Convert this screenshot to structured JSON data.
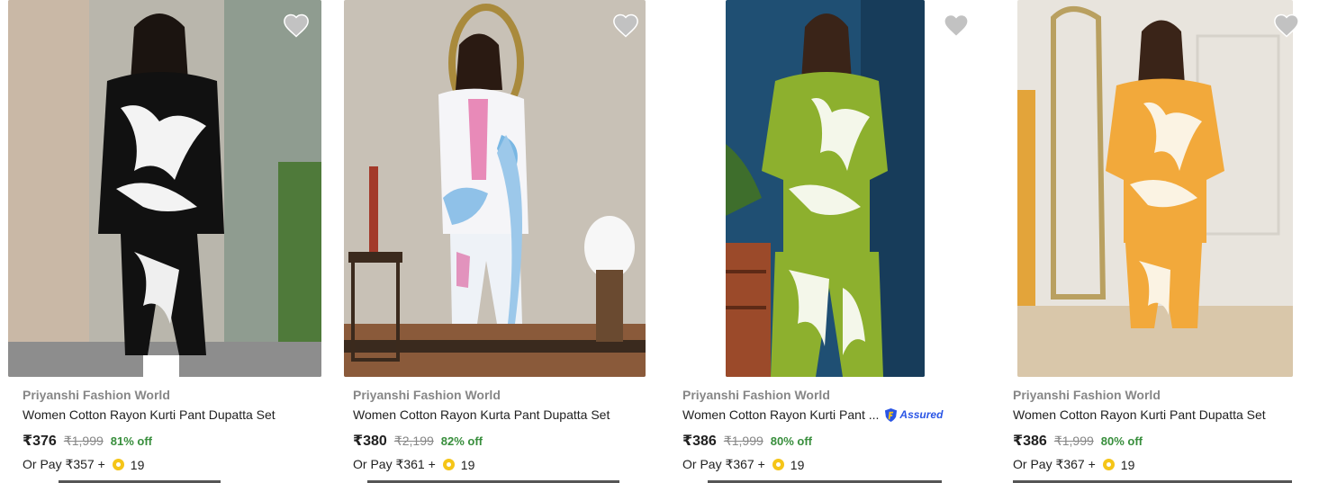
{
  "products": [
    {
      "brand": "Priyanshi Fashion World",
      "title": "Women Cotton Rayon Kurti Pant Dupatta Set",
      "price": "₹376",
      "mrp": "₹1,999",
      "discount": "81% off",
      "pay_prefix": "Or Pay ₹357 +",
      "coins": "19",
      "assured": false,
      "wishlist_icon": "heart-icon",
      "image_desc_color": "#1a1a1a"
    },
    {
      "brand": "Priyanshi Fashion World",
      "title": "Women Cotton Rayon Kurta Pant Dupatta Set",
      "price": "₹380",
      "mrp": "₹2,199",
      "discount": "82% off",
      "pay_prefix": "Or Pay ₹361 +",
      "coins": "19",
      "assured": false,
      "wishlist_icon": "heart-icon",
      "image_desc_color": "#e9edf3"
    },
    {
      "brand": "Priyanshi Fashion World",
      "title": "Women Cotton Rayon Kurti Pant ...",
      "price": "₹386",
      "mrp": "₹1,999",
      "discount": "80% off",
      "pay_prefix": "Or Pay ₹367 +",
      "coins": "19",
      "assured": true,
      "assured_label": "Assured",
      "wishlist_icon": "heart-icon",
      "image_desc_color": "#8db02e"
    },
    {
      "brand": "Priyanshi Fashion World",
      "title": "Women Cotton Rayon Kurti Pant Dupatta Set",
      "price": "₹386",
      "mrp": "₹1,999",
      "discount": "80% off",
      "pay_prefix": "Or Pay ₹367 +",
      "coins": "19",
      "assured": false,
      "wishlist_icon": "heart-icon",
      "image_desc_color": "#f2a93b"
    }
  ],
  "colors": {
    "brand_text": "#878787",
    "discount_green": "#388e3c",
    "assured_blue": "#2a55e5",
    "coin_yellow": "#f5c518",
    "wishlist_gray": "#c2c2c2"
  }
}
